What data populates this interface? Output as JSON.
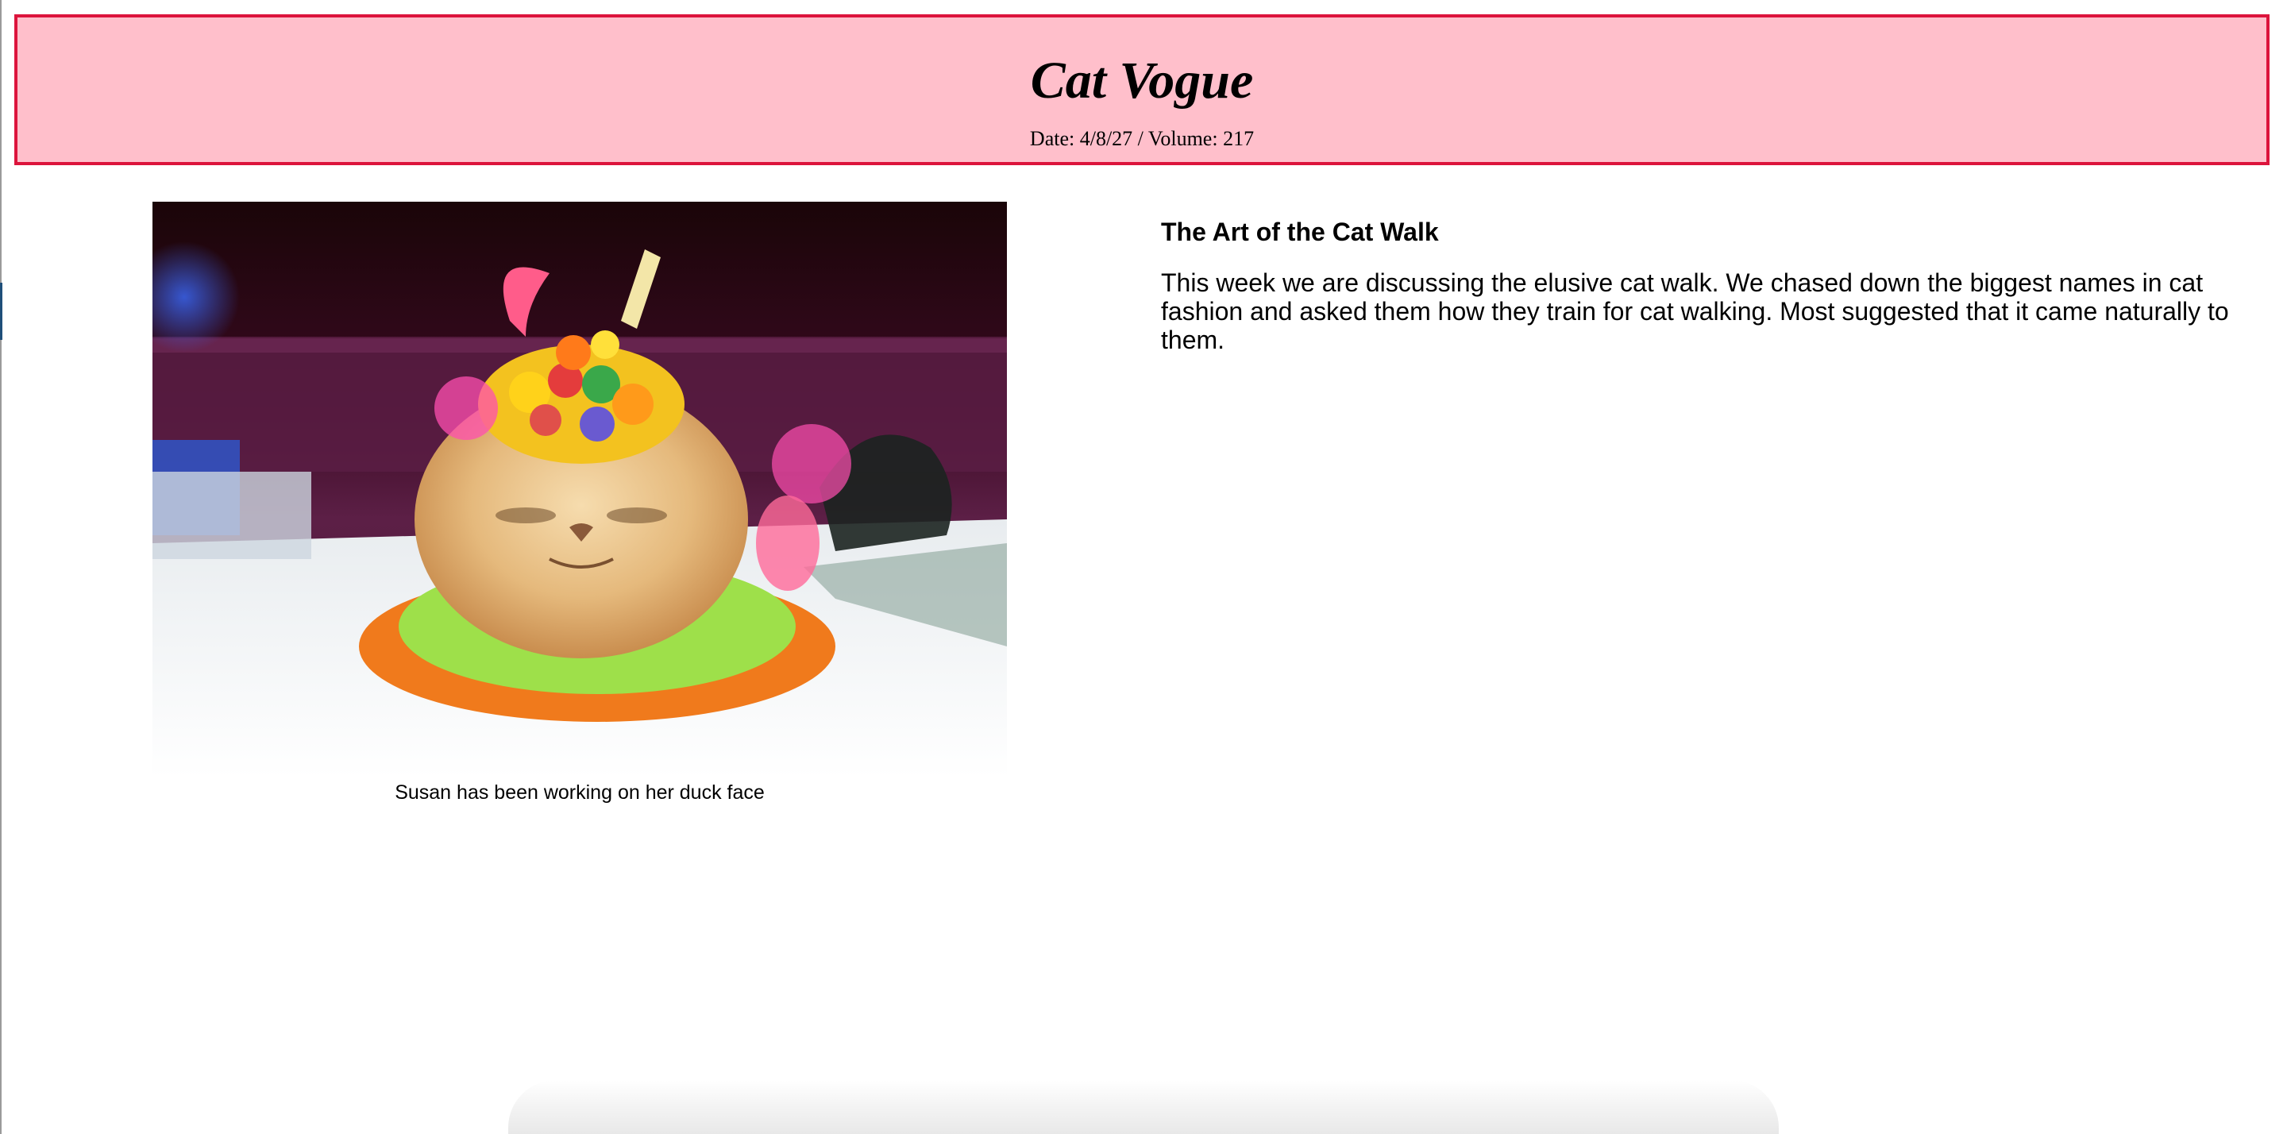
{
  "masthead": {
    "title": "Cat Vogue",
    "meta": "Date: 4/8/27 / Volume: 217"
  },
  "feature": {
    "image_alt": "Cat wearing a fruit hat and a colorful ruffled collar",
    "caption": "Susan has been working on her duck face"
  },
  "article": {
    "title": "The Art of the Cat Walk",
    "body": "This week we are discussing the elusive cat walk. We chased down the biggest names in cat fashion and asked them how they train for cat walking. Most suggested that it came naturally to them."
  },
  "colors": {
    "masthead_background": "#ffbfcb",
    "masthead_border": "#dc143c"
  }
}
